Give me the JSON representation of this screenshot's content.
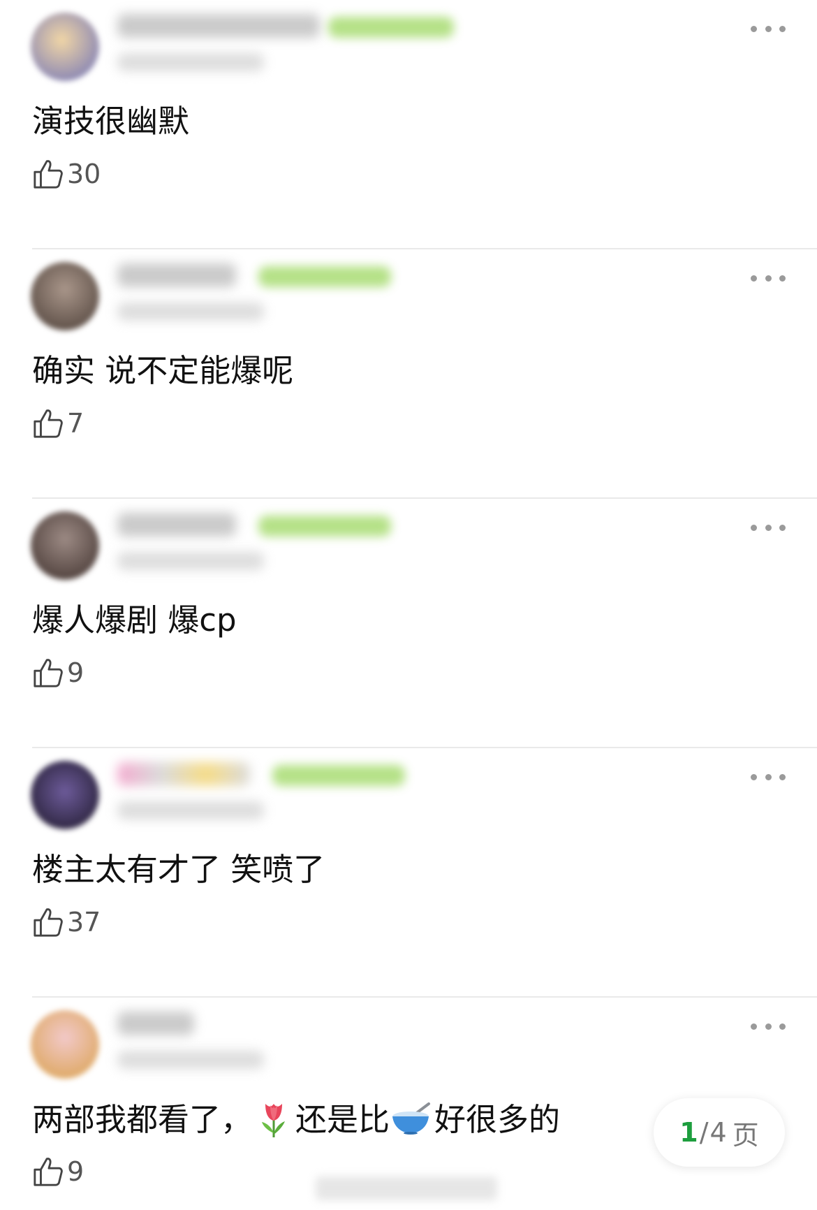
{
  "comments": [
    {
      "text": "演技很幽默",
      "likes": "30",
      "avatar_colors": [
        "#f1d6a6",
        "#6b6fb8"
      ],
      "badge_width": 180,
      "name_width": 290
    },
    {
      "text": "确实 说不定能爆呢",
      "likes": "7",
      "avatar_colors": [
        "#a9968a",
        "#4a3d36"
      ],
      "badge_width": 190,
      "name_width": 170
    },
    {
      "text": "爆人爆剧 爆cp",
      "likes": "9",
      "avatar_colors": [
        "#9c8a84",
        "#3e302c"
      ],
      "badge_width": 190,
      "name_width": 170
    },
    {
      "text": "楼主太有才了 笑喷了",
      "likes": "37",
      "avatar_colors": [
        "#6d5b9a",
        "#1b1626"
      ],
      "badge_width": 190,
      "name_width": 190
    },
    {
      "text_parts": [
        "两部我都看了，",
        "还是比",
        "好很多的"
      ],
      "emoji": [
        "tulip-emoji",
        "bowl-emoji"
      ],
      "likes": "9",
      "avatar_colors": [
        "#f2c9c9",
        "#d9a04a"
      ],
      "badge_width": 0,
      "name_width": 110
    }
  ],
  "pager": {
    "current": "1",
    "separator": "/",
    "total": "4",
    "unit": "页"
  },
  "colors": {
    "accent": "#1d9e3e",
    "badge": "#a8dc72",
    "divider": "#e9e9e9"
  }
}
